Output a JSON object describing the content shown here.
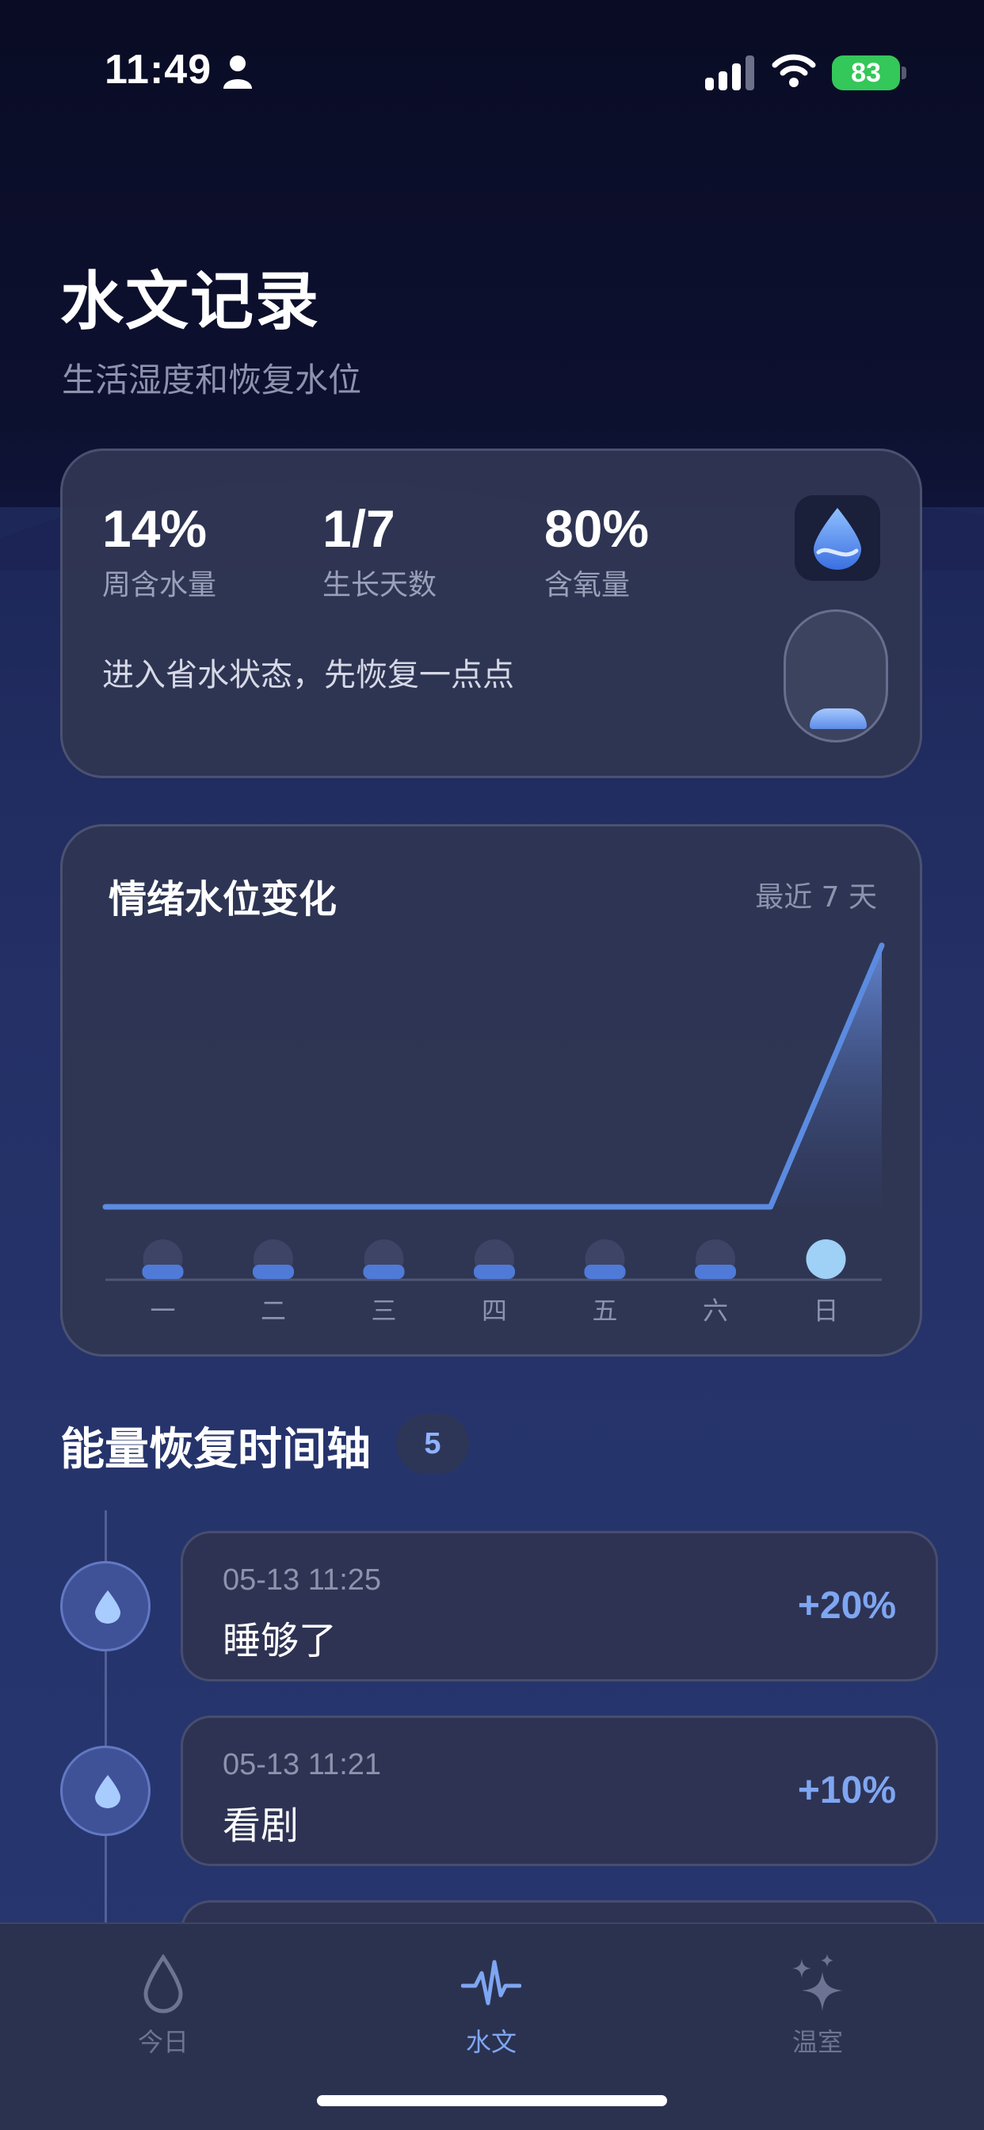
{
  "status_bar": {
    "time": "11:49",
    "battery": "83"
  },
  "header": {
    "title": "水文记录",
    "subtitle": "生活湿度和恢复水位"
  },
  "stats": {
    "items": [
      {
        "value": "14%",
        "label": "周含水量"
      },
      {
        "value": "1/7",
        "label": "生长天数"
      },
      {
        "value": "80%",
        "label": "含氧量"
      }
    ],
    "message": "进入省水状态，先恢复一点点",
    "badge_icon": "water-drop-icon",
    "capsule_level": 0.15
  },
  "chart": {
    "title": "情绪水位变化",
    "range_label": "最近 7 天",
    "day_labels": [
      "一",
      "二",
      "三",
      "四",
      "五",
      "六",
      "日"
    ]
  },
  "chart_data": {
    "type": "area",
    "title": "情绪水位变化",
    "categories": [
      "一",
      "二",
      "三",
      "四",
      "五",
      "六",
      "日"
    ],
    "values": [
      0,
      0,
      0,
      0,
      0,
      0,
      20
    ],
    "ylim": [
      0,
      20
    ],
    "colors": {
      "line": "#5b8be0",
      "today_dot": "#9fd0f5",
      "past_bar": "#4f7ad8"
    }
  },
  "timeline": {
    "title": "能量恢复时间轴",
    "count": "5",
    "items": [
      {
        "time": "05-13 11:25",
        "text": "睡够了",
        "value": "+20%"
      },
      {
        "time": "05-13 11:21",
        "text": "看剧",
        "value": "+10%"
      }
    ]
  },
  "tab_bar": {
    "tabs": [
      {
        "label": "今日",
        "icon": "drop-outline-icon",
        "active": false
      },
      {
        "label": "水文",
        "icon": "pulse-icon",
        "active": true
      },
      {
        "label": "温室",
        "icon": "sparkles-icon",
        "active": false
      }
    ]
  },
  "colors": {
    "accent": "#7ea6f2",
    "battery": "#34c759"
  }
}
